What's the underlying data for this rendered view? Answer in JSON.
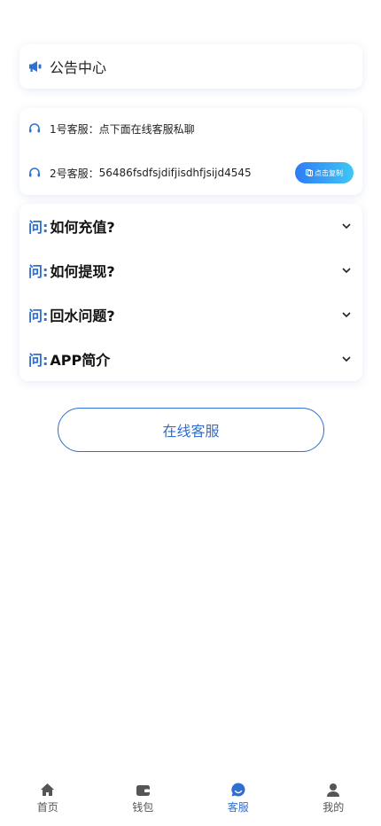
{
  "notice": {
    "title": "公告中心",
    "icon": "megaphone-icon"
  },
  "service": {
    "rows": [
      {
        "label": "1号客服：",
        "text": "点下面在线客服私聊"
      },
      {
        "label": "2号客服：",
        "text": "56486fsdfsjdifjisdhfjsijd4545"
      }
    ],
    "copy_label": "点击复制"
  },
  "faq": {
    "prefix": "问:",
    "items": [
      {
        "title": "如何充值?"
      },
      {
        "title": "如何提现?"
      },
      {
        "title": "回水问题?"
      },
      {
        "title": "APP简介"
      }
    ]
  },
  "online_button": "在线客服",
  "tabbar": {
    "items": [
      {
        "label": "首页",
        "icon": "home-icon"
      },
      {
        "label": "钱包",
        "icon": "wallet-icon"
      },
      {
        "label": "客服",
        "icon": "chat-icon"
      },
      {
        "label": "我的",
        "icon": "user-icon"
      }
    ],
    "active_index": 2
  },
  "colors": {
    "accent": "#2f6fd1",
    "gradient_start": "#2f7bf5",
    "gradient_end": "#3ec7f5"
  }
}
